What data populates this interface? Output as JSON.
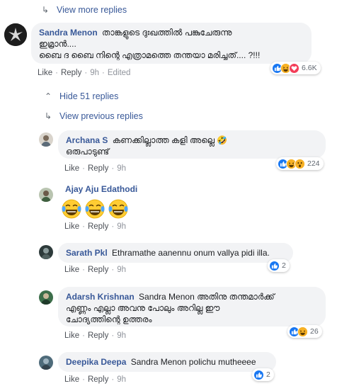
{
  "view_more_replies": "View more replies",
  "hide_replies": "Hide 51 replies",
  "view_previous_replies": "View previous replies",
  "actions": {
    "like": "Like",
    "reply": "Reply",
    "sep": "·"
  },
  "comments": [
    {
      "author": "Sandra Menon",
      "text_line1": "താങ്കളുടെ ദുഃഖത്തിൽ പങ്കുചേരുന്നു",
      "text_line2": "ഇമ്രാൻ....",
      "text_line3": "ബൈ ദ ബൈ നിന്റെ എത്രാമത്തെ തന്തയാ മരിച്ചത്.... ?!!!",
      "time": "9h",
      "edited": "Edited",
      "reaction_count": "6.6K"
    },
    {
      "author": "Archana S",
      "text_line1": "കണക്കില്ലാത്ത കളി അല്ലെ 🤣",
      "text_line2": "ഒരുപാടുണ്ട്",
      "time": "9h",
      "reaction_count": "224"
    },
    {
      "author": "Ajay Aju Edathodi",
      "time": "9h"
    },
    {
      "author": "Sarath Pkl",
      "text_line1": "Ethramathe aanennu onum vallya pidi illa.",
      "time": "9h",
      "reaction_count": "2"
    },
    {
      "author": "Adarsh Krishnan",
      "text_line1": "Sandra Menon അതിനു തന്തമാർക്ക്",
      "text_line2": "എണ്ണം എല്ലാ അവനു പോലും അറില്ല ഈ",
      "text_line3": "ചോദ്യത്തിന്റെ ഉത്തരം",
      "time": "9h",
      "reaction_count": "26"
    },
    {
      "author": "Deepika Deepa",
      "text_line1": "Sandra Menon polichu mutheeee",
      "time": "9h",
      "reaction_count": "2"
    }
  ],
  "colors": {
    "link": "#385898",
    "bubble": "#f2f3f5",
    "like": "#1877f2",
    "haha": "#f7b125",
    "love": "#f33e58"
  }
}
